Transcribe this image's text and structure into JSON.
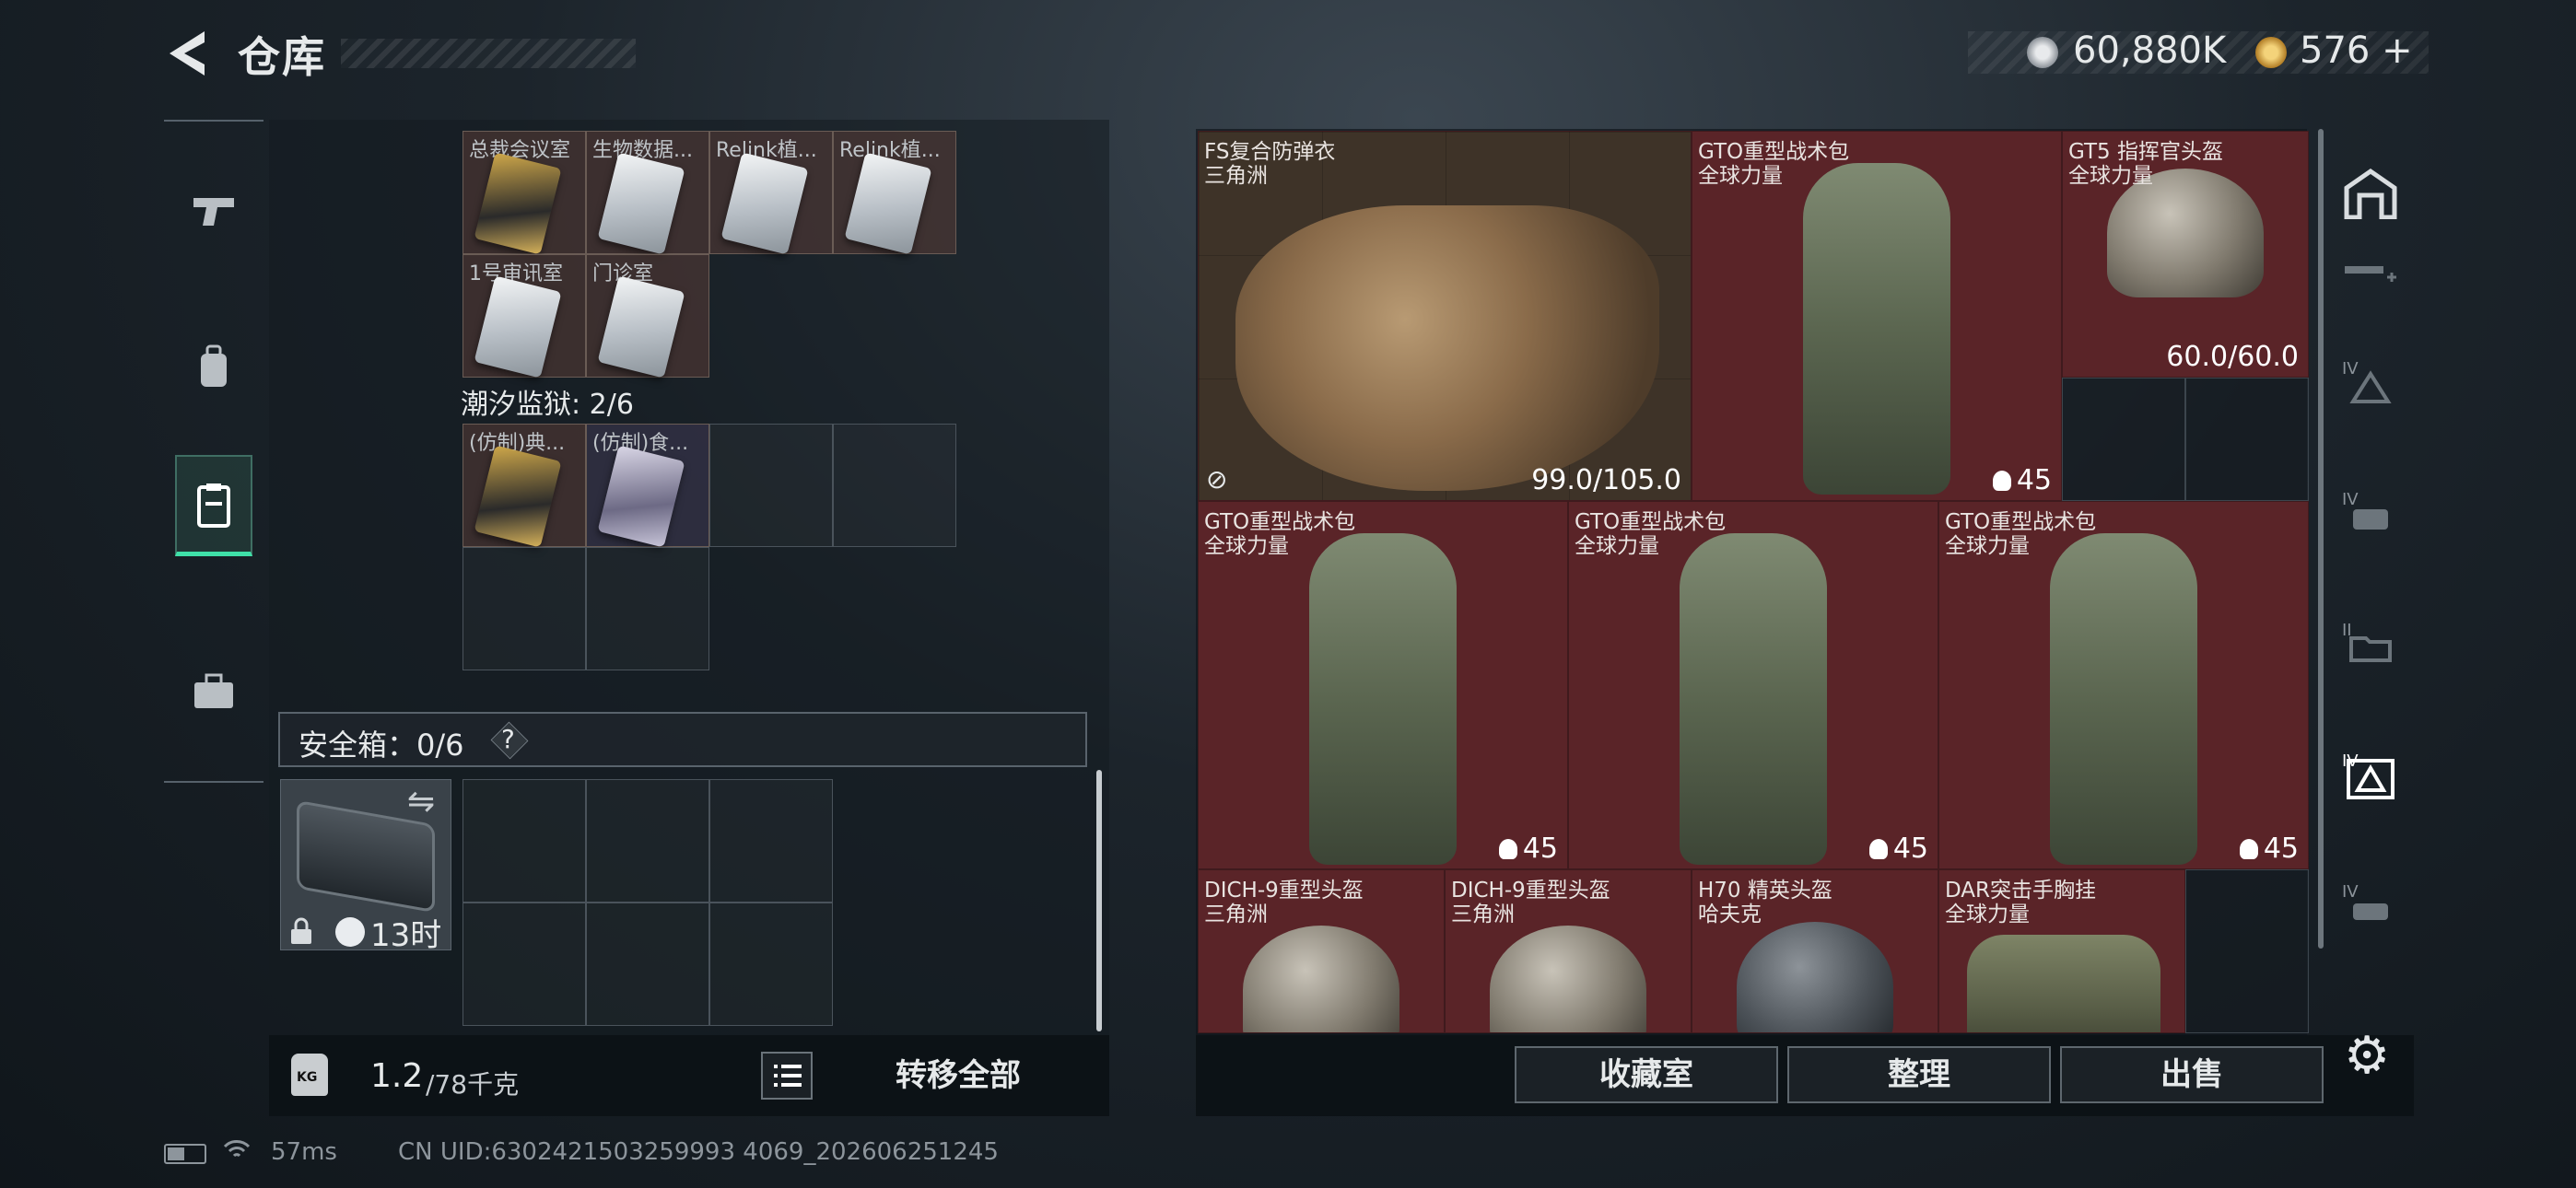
{
  "header": {
    "title": "仓库",
    "currency": {
      "silver": "60,880K",
      "gold": "576",
      "gold_add": "+"
    }
  },
  "left_panel": {
    "card_slots": [
      {
        "name": "总裁会议室",
        "style": "gold"
      },
      {
        "name": "生物数据...",
        "style": "silver"
      },
      {
        "name": "Relink植...",
        "style": "silver"
      },
      {
        "name": "Relink植...",
        "style": "silver"
      },
      {
        "name": "1号审讯室",
        "style": "silver"
      },
      {
        "name": "门诊室",
        "style": "silver"
      }
    ],
    "prison": {
      "label": "潮汐监狱: 2/6",
      "slots": [
        {
          "name": "(仿制)典...",
          "style": "gold"
        },
        {
          "name": "(仿制)食...",
          "style": "violet"
        }
      ]
    },
    "safebox": {
      "label": "安全箱：0/6",
      "help": "?",
      "timer": "13时"
    },
    "weight": {
      "icon_text": "KG",
      "current": "1.2",
      "max": "/78千克"
    },
    "transfer_all": "转移全部"
  },
  "stash": {
    "items": [
      {
        "name": "FS复合防弹衣",
        "sub": "三角洲",
        "value": "99.0/105.0",
        "type": "vest"
      },
      {
        "name": "GTO重型战术包",
        "sub": "全球力量",
        "value": "45",
        "type": "bag"
      },
      {
        "name": "GT5 指挥官头盔",
        "sub": "全球力量",
        "value": "60.0/60.0",
        "type": "helmet"
      },
      {
        "name": "GTO重型战术包",
        "sub": "全球力量",
        "value": "45",
        "type": "bag"
      },
      {
        "name": "GTO重型战术包",
        "sub": "全球力量",
        "value": "45",
        "type": "bag"
      },
      {
        "name": "GTO重型战术包",
        "sub": "全球力量",
        "value": "45",
        "type": "bag"
      },
      {
        "name": "DICH-9重型头盔",
        "sub": "三角洲",
        "type": "helmet"
      },
      {
        "name": "DICH-9重型头盔",
        "sub": "三角洲",
        "type": "helmet"
      },
      {
        "name": "H70 精英头盔",
        "sub": "哈夫克",
        "type": "helmet-dark"
      },
      {
        "name": "DAR突击手胸挂",
        "sub": "全球力量",
        "type": "rig"
      }
    ],
    "actions": {
      "collection": "收藏室",
      "sort": "整理",
      "sell": "出售"
    }
  },
  "right_rail": {
    "tiers": [
      "IV",
      "IV",
      "II",
      "IV",
      "IV"
    ]
  },
  "footer": {
    "ping": "57ms",
    "uid": "CN UID:6302421503259993 4069_202606251245"
  },
  "colors": {
    "accent": "#3fe0a8",
    "rare_red": "#5a2428",
    "brown": "#3e3328"
  }
}
